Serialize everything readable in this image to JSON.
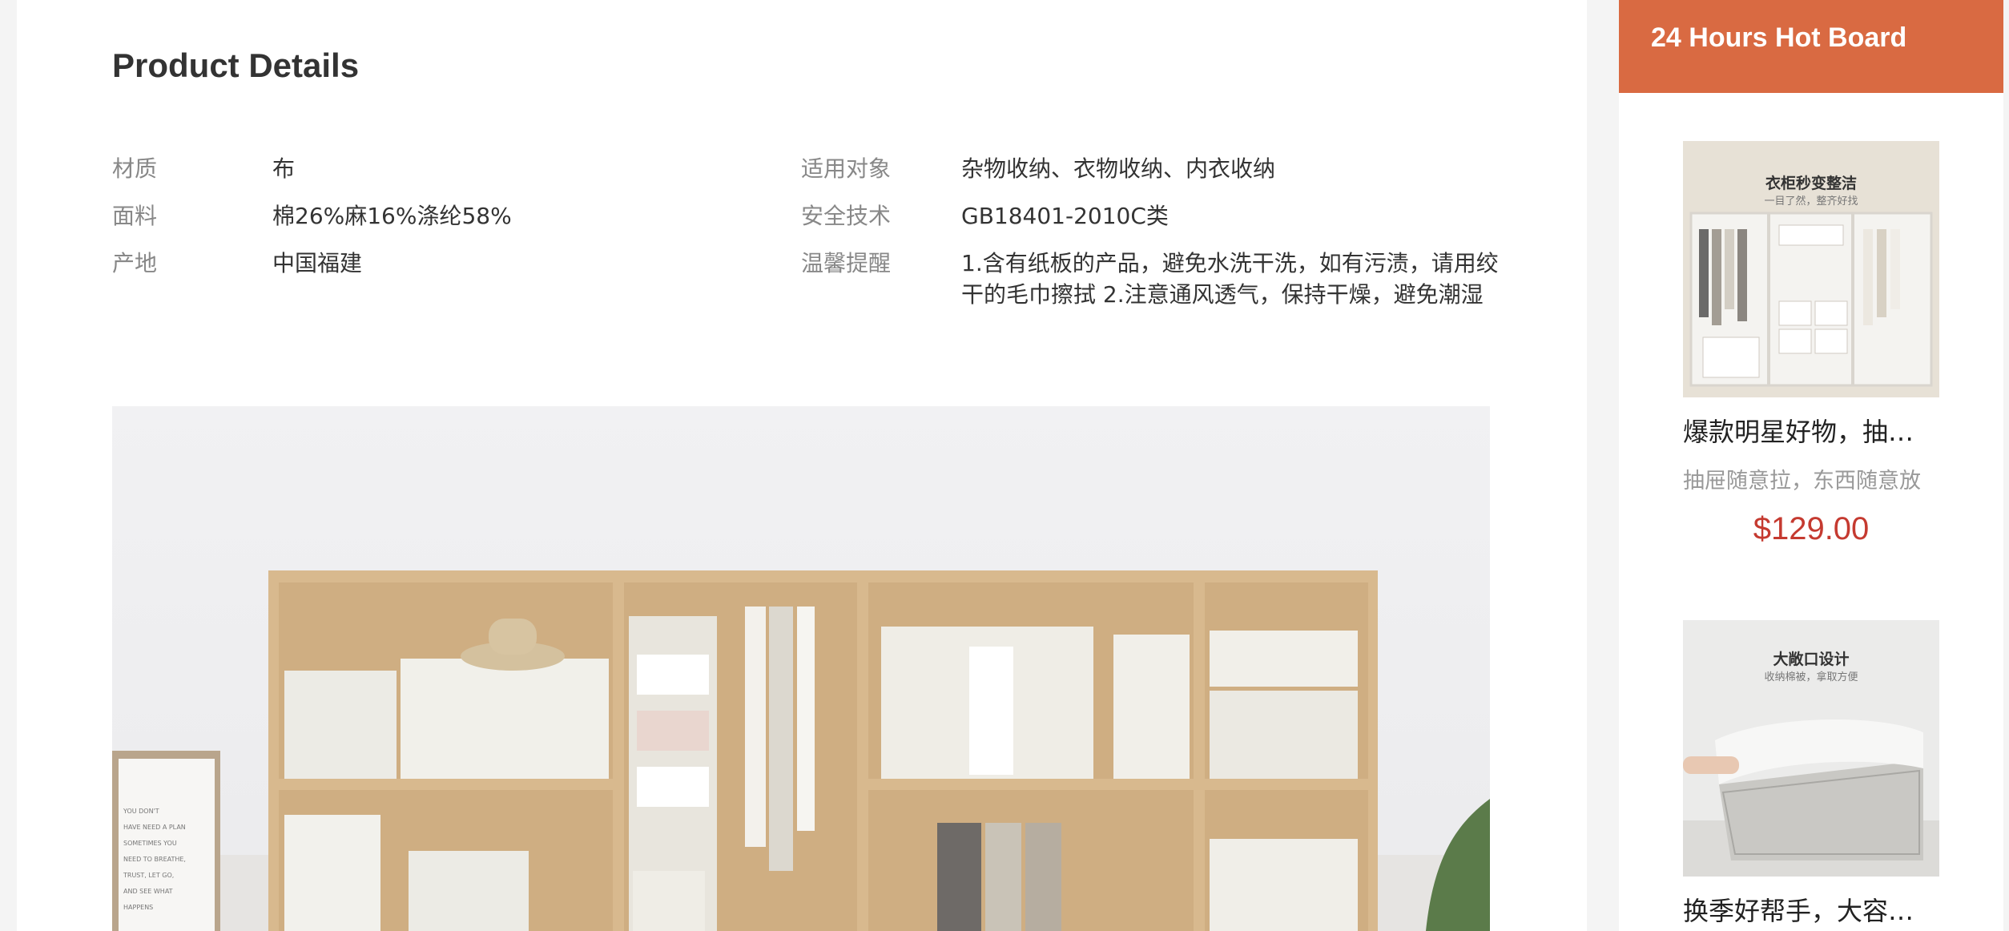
{
  "product_details": {
    "title": "Product Details",
    "attributes_left": [
      {
        "label": "材质",
        "value": "布"
      },
      {
        "label": "面料",
        "value": "棉26%麻16%涤纶58%"
      },
      {
        "label": "产地",
        "value": "中国福建"
      }
    ],
    "attributes_right": [
      {
        "label": "适用对象",
        "value": "杂物收纳、衣物收纳、内衣收纳"
      },
      {
        "label": "安全技术",
        "value": "GB18401-2010C类"
      },
      {
        "label": "温馨提醒",
        "value": "1.含有纸板的产品，避免水洗干洗，如有污渍，请用绞干的毛巾擦拭 2.注意通风透气，保持干燥，避免潮湿"
      }
    ],
    "hero_image": {
      "sign_text": "YOU DON'T HAVE NEED A PLAN SOMETIMES YOU NEED TO BREATHE, TRUST, LET GO, AND SEE WHAT HAPPENS"
    }
  },
  "hot_board": {
    "title": "24 Hours Hot Board",
    "items": [
      {
        "name": "爆款明星好物，抽屉式收纳",
        "desc": "抽屉随意拉，东西随意放",
        "price": "$129.00",
        "image_caption": "衣柜秒变整洁",
        "image_subcaption": "一目了然，整齐好找"
      },
      {
        "name": "换季好帮手，大容量收纳",
        "desc": "",
        "price": "",
        "image_caption": "大敞口设计",
        "image_subcaption": "收纳棉被，拿取方便"
      }
    ]
  },
  "colors": {
    "accent": "#d96a42",
    "price": "#c53a30"
  }
}
